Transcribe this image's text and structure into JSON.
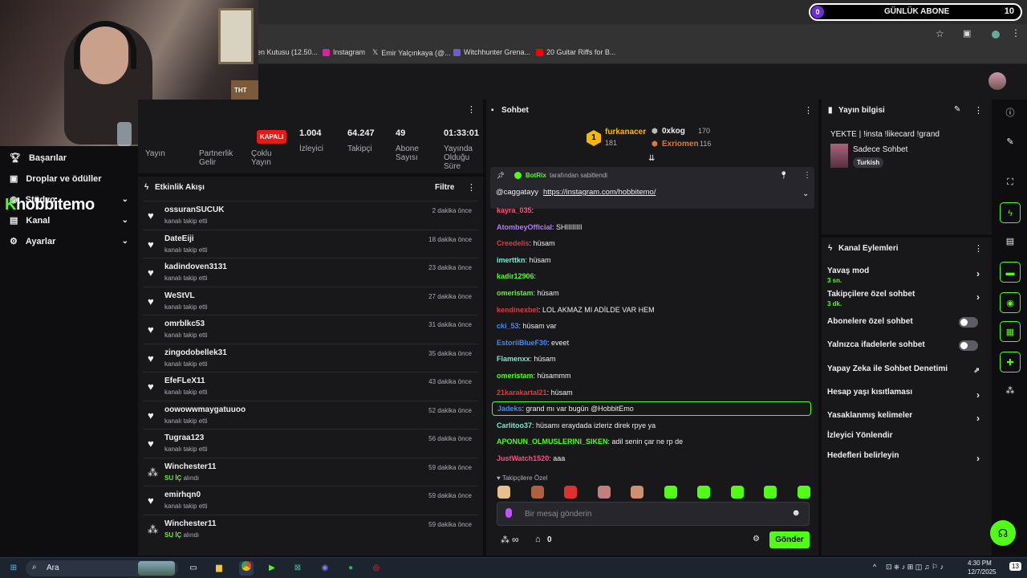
{
  "browser": {
    "bookmarks": [
      "len Kutusu (12.50...",
      "Instagram",
      "Emir Yalçınkaya (@...",
      "Witchhunter Grena...",
      "20 Guitar Riffs for B..."
    ]
  },
  "counter": {
    "left": "0",
    "label": "GÜNLÜK ABONE",
    "right": "10"
  },
  "webcam": {
    "badge": "THT"
  },
  "nav": {
    "items": [
      {
        "label": "Başarılar",
        "icon": "trophy-icon"
      },
      {
        "label": "Droplar ve ödüller",
        "icon": "gift-icon"
      },
      {
        "label": "Stüdyo",
        "icon": "studio-icon"
      },
      {
        "label": "Kanal",
        "icon": "channel-icon"
      },
      {
        "label": "Ayarlar",
        "icon": "gear-icon"
      }
    ],
    "logo": "hobbitemo",
    "logo_k": "K"
  },
  "stats": {
    "live_badge": "KAPALI",
    "items": [
      {
        "value": "",
        "label": "Yayın"
      },
      {
        "value": "",
        "label": "Partnerlik Gelir"
      },
      {
        "value": "",
        "label": "Çoklu Yayın"
      },
      {
        "value": "1.004",
        "label": "İzleyici"
      },
      {
        "value": "64.247",
        "label": "Takipçi"
      },
      {
        "value": "49",
        "label": "Abone Sayısı"
      },
      {
        "value": "01:33:01",
        "label": "Yayında Olduğu Süre"
      }
    ]
  },
  "activity": {
    "title": "Etkinlik Akışı",
    "filter": "Filtre",
    "follow_text": "kanalı takip etti",
    "rows": [
      {
        "name": "ossuranSUCUK",
        "type": "follow",
        "time": "2 dakika önce"
      },
      {
        "name": "DateEiji",
        "type": "follow",
        "time": "18 dakika önce"
      },
      {
        "name": "kadindoven3131",
        "type": "follow",
        "time": "23 dakika önce"
      },
      {
        "name": "WeStVL",
        "type": "follow",
        "time": "27 dakika önce"
      },
      {
        "name": "omrblkc53",
        "type": "follow",
        "time": "31 dakika önce"
      },
      {
        "name": "zingodobellek31",
        "type": "follow",
        "time": "35 dakika önce"
      },
      {
        "name": "EfeFLeX11",
        "type": "follow",
        "time": "43 dakika önce"
      },
      {
        "name": "oowowwmaygatuuoo",
        "type": "follow",
        "time": "52 dakika önce"
      },
      {
        "name": "Tugraa123",
        "type": "follow",
        "time": "56 dakika önce"
      },
      {
        "name": "Winchester11",
        "type": "reward",
        "reward": "SU İÇ",
        "reward_text": "alındı",
        "time": "59 dakika önce"
      },
      {
        "name": "emirhqn0",
        "type": "follow",
        "time": "59 dakika önce"
      },
      {
        "name": "Winchester11",
        "type": "reward",
        "reward": "SU İÇ",
        "reward_text": "alındı",
        "time": "59 dakika önce"
      }
    ]
  },
  "chat": {
    "title": "Sohbet",
    "leaders": [
      {
        "rank": "1",
        "name": "furkanacer",
        "count": "181"
      },
      {
        "name": "0xkog",
        "count": "170"
      },
      {
        "name": "Exriomen",
        "count": "116"
      }
    ],
    "pinned": {
      "by": "BotRix",
      "by_text": "tarafından sabitlendi",
      "user": "@caggatayy",
      "link": "https://instagram.com/hobbitemo/"
    },
    "messages": [
      {
        "user": "kayra_035",
        "text": "",
        "color": "#ff4f7a"
      },
      {
        "user": "AtombeyOfficial",
        "text": "SHIIIIIIII",
        "color": "#b57bff"
      },
      {
        "user": "Creedelis",
        "text": "hüsam",
        "color": "#e0393e"
      },
      {
        "user": "imerttkn",
        "text": "hüsam",
        "color": "#7fe8d3"
      },
      {
        "user": "kadir12906",
        "text": "",
        "color": "#53fc18"
      },
      {
        "user": "omeristam",
        "text": "hüsam",
        "color": "#53fc18"
      },
      {
        "user": "kendinexbel",
        "text": "LOL AKMAZ MI ADİLDE VAR HEM",
        "color": "#e0393e"
      },
      {
        "user": "cki_53",
        "text": "hüsam var",
        "color": "#3b8bff"
      },
      {
        "user": "EstoriiBlueF30",
        "text": "eveet",
        "color": "#3b8bff"
      },
      {
        "user": "Flamenxx",
        "text": "hüsam",
        "color": "#7fe8d3"
      },
      {
        "user": "omeristam",
        "text": "hüsammm",
        "color": "#53fc18"
      },
      {
        "user": "21karakartal21",
        "text": "hüsam",
        "color": "#e0393e"
      },
      {
        "user": "Jadeks",
        "text": "grand mı var bugün @HobbitEmo",
        "color": "#3b8bff"
      },
      {
        "user": "Carlitoo37",
        "text": "hüsamı eraydada izleriz direk rpye ya",
        "color": "#7fe8d3"
      },
      {
        "user": "APONUN_OLMUSLERINI_SIKEN",
        "text": "adil senin çar ne rp de",
        "color": "#53fc18"
      },
      {
        "user": "JustWatch1520",
        "text": "aaa",
        "color": "#ff4f7a"
      }
    ],
    "emote_label": "Takipçilere Özel",
    "input_placeholder": "Bir mesaj gönderin",
    "points": "∞",
    "gift_count": "0",
    "send_label": "Gönder"
  },
  "info": {
    "title": "Yayın bilgisi",
    "stream_title": "YEKTE | !insta !likecard !grand",
    "category": "Sadece Sohbet",
    "tag": "Turkish"
  },
  "actions": {
    "title": "Kanal Eylemleri",
    "items": [
      {
        "label": "Yavaş mod",
        "sub": "3 sn.",
        "kind": "arrow"
      },
      {
        "label": "Takipçilere özel sohbet",
        "sub": "3 dk.",
        "kind": "arrow"
      },
      {
        "label": "Abonelere özel sohbet",
        "sub": "",
        "kind": "toggle"
      },
      {
        "label": "Yalnızca ifadelerle sohbet",
        "sub": "",
        "kind": "toggle"
      },
      {
        "label": "Yapay Zeka ile Sohbet Denetimi",
        "sub": "",
        "kind": "external"
      },
      {
        "label": "Hesap yaşı kısıtlaması",
        "sub": "",
        "kind": "arrow"
      },
      {
        "label": "Yasaklanmış kelimeler",
        "sub": "",
        "kind": "arrow"
      },
      {
        "label": "İzleyici Yönlendir",
        "sub": "",
        "kind": "none"
      },
      {
        "label": "Hedefleri belirleyin",
        "sub": "",
        "kind": "arrow"
      }
    ]
  },
  "taskbar": {
    "search": "Ara",
    "time": "4:30 PM",
    "date": "12/7/2025",
    "notif": "13"
  },
  "colors": {
    "accent": "#53fc18",
    "bg": "#0e0e10",
    "panel": "#18181b"
  }
}
